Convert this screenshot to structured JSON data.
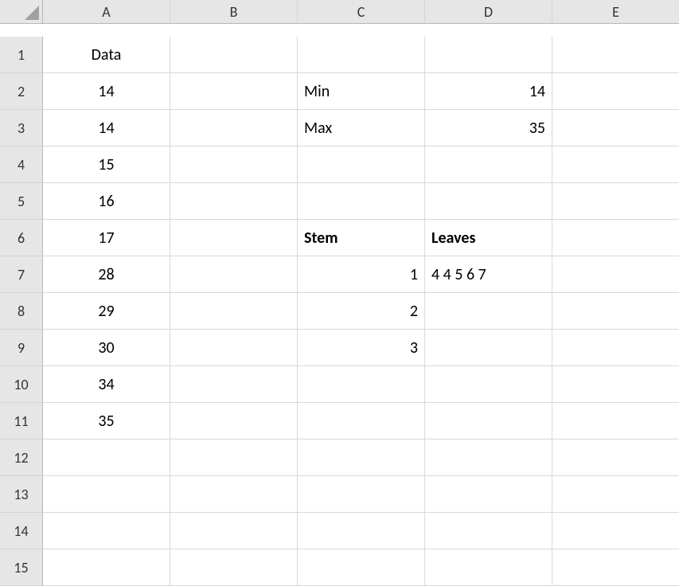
{
  "headers": {
    "cols": [
      "A",
      "B",
      "C",
      "D",
      "E"
    ],
    "rows": [
      1,
      2,
      3,
      4,
      5,
      6,
      7,
      8,
      9,
      10,
      11,
      12,
      13,
      14,
      15
    ]
  },
  "cells": {
    "A1": "Data",
    "A2": 14,
    "A3": 14,
    "A4": 15,
    "A5": 16,
    "A6": 17,
    "A7": 28,
    "A8": 29,
    "A9": 30,
    "A10": 34,
    "A11": 35,
    "C2": "Min",
    "C3": "Max",
    "D2": 14,
    "D3": 35,
    "C6": "Stem",
    "D6": "Leaves",
    "C7": 1,
    "C8": 2,
    "C9": 3,
    "D7": "4  4  5  6  7"
  }
}
